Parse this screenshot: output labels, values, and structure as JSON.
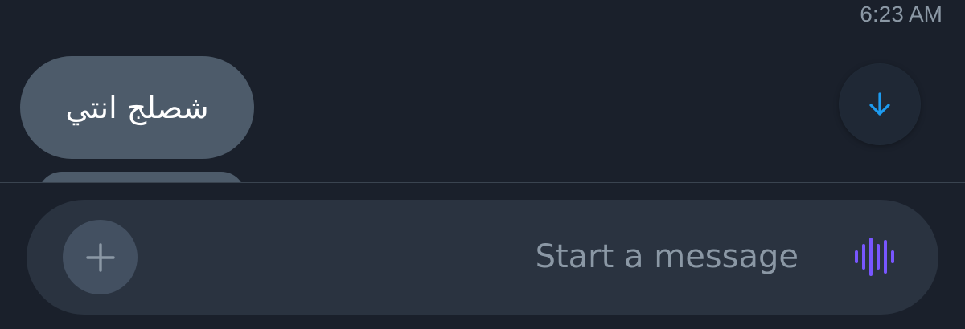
{
  "conversation": {
    "timestamp": "6:23 AM",
    "messages": [
      {
        "text": "شصلج انتي"
      }
    ]
  },
  "composer": {
    "placeholder": "Start a message",
    "add_icon": "plus-icon",
    "voice_icon": "voice-waveform-icon"
  },
  "scroll_button": {
    "icon": "arrow-down-icon"
  },
  "colors": {
    "background": "#1a202b",
    "bubble": "#4d5b6a",
    "composer": "#2a3340",
    "accent_blue": "#1d9bf0",
    "accent_purple": "#7856ff",
    "muted_text": "#8b98a5"
  }
}
